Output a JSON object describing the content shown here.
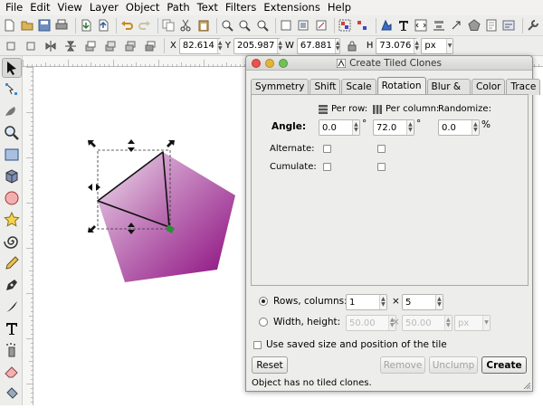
{
  "menu": [
    "File",
    "Edit",
    "View",
    "Layer",
    "Object",
    "Path",
    "Text",
    "Filters",
    "Extensions",
    "Help"
  ],
  "controls": {
    "x_label": "X",
    "x_value": "82.614",
    "y_label": "Y",
    "y_value": "205.987",
    "w_label": "W",
    "w_value": "67.881",
    "h_label": "H",
    "h_value": "73.076",
    "unit": "px"
  },
  "dialog": {
    "title": "Create Tiled Clones",
    "tabs": [
      "Symmetry",
      "Shift",
      "Scale",
      "Rotation",
      "Blur & opacity",
      "Color",
      "Trace"
    ],
    "selected_tab": "Rotation",
    "headers": {
      "per_row": "Per row:",
      "per_column": "Per column:",
      "randomize": "Randomize:"
    },
    "angle_label": "Angle:",
    "angle_per_row": "0.0",
    "angle_per_column": "72.0",
    "angle_randomize": "0.0",
    "degree_symbol": "°",
    "percent_symbol": "%",
    "alternate_label": "Alternate:",
    "cumulate_label": "Cumulate:",
    "rows_columns_label": "Rows, columns:",
    "rows_value": "1",
    "columns_value": "5",
    "times_symbol": "×",
    "width_height_label": "Width, height:",
    "width_value": "50.00",
    "height_value": "50.00",
    "size_unit": "px",
    "use_saved_label": "Use saved size and position of the tile",
    "buttons": {
      "reset": "Reset",
      "remove": "Remove",
      "unclump": "Unclump",
      "create": "Create"
    },
    "status": "Object has no tiled clones."
  },
  "colors": {
    "pentagon_light": "#ecd6ea",
    "pentagon_dark": "#8b0a7e",
    "tile_light": "#f3e6f2",
    "tile_dark": "#b05aa6"
  }
}
